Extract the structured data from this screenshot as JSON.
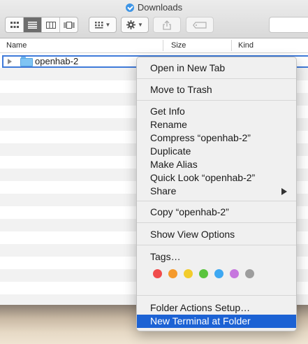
{
  "window": {
    "title": "Downloads"
  },
  "columns": [
    "Name",
    "Size",
    "Kind"
  ],
  "file": {
    "name": "openhab-2"
  },
  "menu": {
    "open_new_tab": "Open in New Tab",
    "move_to_trash": "Move to Trash",
    "get_info": "Get Info",
    "rename": "Rename",
    "compress": "Compress “openhab-2”",
    "duplicate": "Duplicate",
    "make_alias": "Make Alias",
    "quick_look": "Quick Look “openhab-2”",
    "share": "Share",
    "copy": "Copy “openhab-2”",
    "show_view_options": "Show View Options",
    "tags": "Tags…",
    "folder_actions": "Folder Actions Setup…",
    "new_terminal": "New Terminal at Folder"
  },
  "tag_colors": [
    {
      "name": "red",
      "hex": "#f04b4b"
    },
    {
      "name": "orange",
      "hex": "#f59a2c"
    },
    {
      "name": "yellow",
      "hex": "#f2cc2c"
    },
    {
      "name": "green",
      "hex": "#5ac43d"
    },
    {
      "name": "blue",
      "hex": "#3ea8f2"
    },
    {
      "name": "purple",
      "hex": "#c677de"
    },
    {
      "name": "gray",
      "hex": "#9d9d9d"
    }
  ],
  "icons": {
    "window_title": "downloads-folder-icon",
    "view_icon": "icon-view-icon",
    "view_list": "list-view-icon",
    "view_column": "column-view-icon",
    "view_coverflow": "coverflow-view-icon",
    "arrange": "arrange-grid-icon",
    "action": "gear-icon",
    "share": "share-icon",
    "tag": "tag-icon",
    "submenu": "chevron-right-icon"
  },
  "accent": "#1c62d4"
}
